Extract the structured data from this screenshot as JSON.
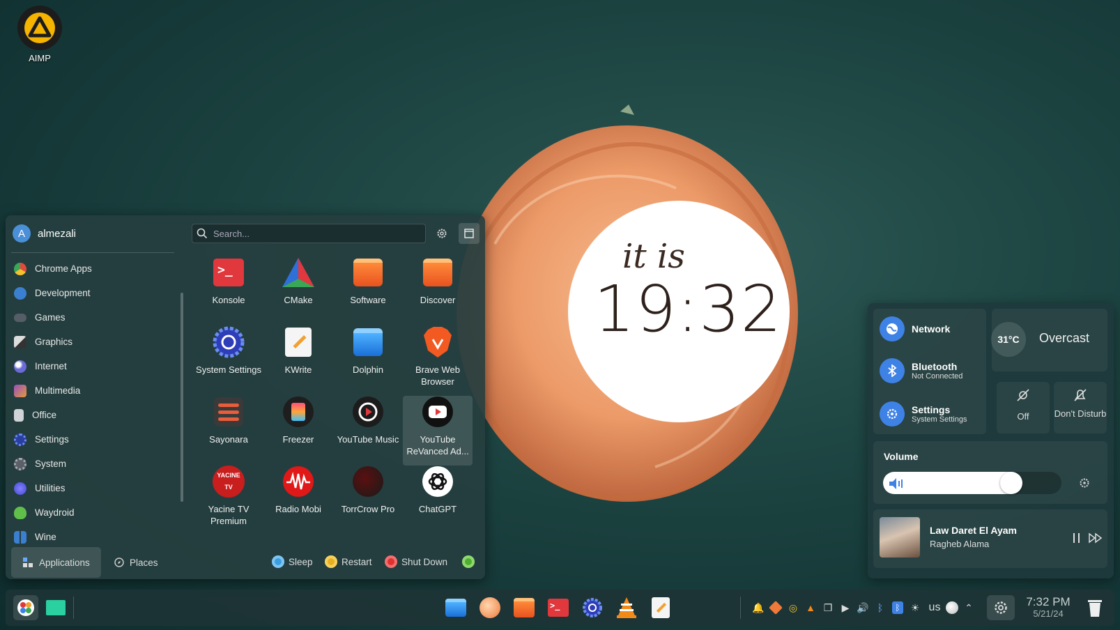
{
  "desktop": {
    "icon_label": "AIMP"
  },
  "clock": {
    "prefix": "it is",
    "time": "19:32"
  },
  "launcher": {
    "username": "almezali",
    "avatar_letter": "A",
    "search_placeholder": "Search...",
    "categories": [
      {
        "label": "Chrome Apps",
        "color": "#e04a3a"
      },
      {
        "label": "Development",
        "color": "#3b7fd1"
      },
      {
        "label": "Games",
        "color": "#555e66"
      },
      {
        "label": "Graphics",
        "color": "#8a8f94"
      },
      {
        "label": "Internet",
        "color": "#6a6ad8"
      },
      {
        "label": "Multimedia",
        "color": "#9a4fc0"
      },
      {
        "label": "Office",
        "color": "#d0d4d8"
      },
      {
        "label": "Settings",
        "color": "#4a6fdc"
      },
      {
        "label": "System",
        "color": "#8a9096"
      },
      {
        "label": "Utilities",
        "color": "#3a4fd0"
      },
      {
        "label": "Waydroid",
        "color": "#5fbf4a"
      },
      {
        "label": "Wine",
        "color": "#3a7fd0"
      }
    ],
    "apps": [
      {
        "label": "Konsole",
        "icon": "konsole-icon"
      },
      {
        "label": "CMake",
        "icon": "cmake-icon"
      },
      {
        "label": "Software",
        "icon": "software-store-icon"
      },
      {
        "label": "Discover",
        "icon": "discover-icon"
      },
      {
        "label": "System Settings",
        "icon": "system-settings-icon"
      },
      {
        "label": "KWrite",
        "icon": "kwrite-icon"
      },
      {
        "label": "Dolphin",
        "icon": "dolphin-icon"
      },
      {
        "label": "Brave Web Browser",
        "icon": "brave-icon"
      },
      {
        "label": "Sayonara",
        "icon": "sayonara-icon"
      },
      {
        "label": "Freezer",
        "icon": "freezer-icon"
      },
      {
        "label": "YouTube Music",
        "icon": "youtube-music-icon"
      },
      {
        "label": "YouTube ReVanced Ad...",
        "icon": "youtube-revanced-icon"
      },
      {
        "label": "Yacine TV Premium",
        "icon": "yacine-tv-icon"
      },
      {
        "label": "Radio Mobi",
        "icon": "radio-mobi-icon"
      },
      {
        "label": "TorrCrow Pro",
        "icon": "torrcrow-icon"
      },
      {
        "label": "ChatGPT",
        "icon": "chatgpt-icon"
      }
    ],
    "tabs": {
      "applications": "Applications",
      "places": "Places"
    },
    "power": {
      "sleep": "Sleep",
      "restart": "Restart",
      "shutdown": "Shut Down"
    }
  },
  "quick_settings": {
    "network": {
      "title": "Network"
    },
    "bluetooth": {
      "title": "Bluetooth",
      "status": "Not Connected"
    },
    "settings": {
      "title": "Settings",
      "subtitle": "System Settings"
    },
    "weather": {
      "temp": "31°C",
      "condition": "Overcast"
    },
    "night_light": {
      "label": "Off"
    },
    "dnd": {
      "label": "Don't Disturb"
    },
    "volume": {
      "label": "Volume",
      "level": 0.72
    },
    "now_playing": {
      "title": "Law Daret El Ayam",
      "artist": "Ragheb Alama"
    }
  },
  "taskbar": {
    "time": "7:32 PM",
    "date": "5/21/24",
    "keyboard_layout": "us"
  }
}
